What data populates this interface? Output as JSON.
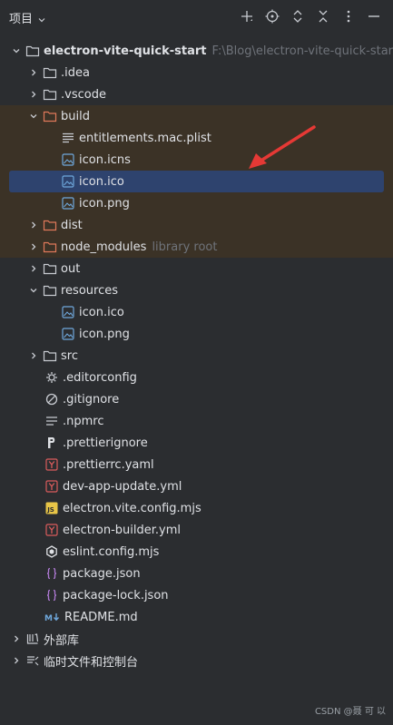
{
  "header": {
    "title": "项目",
    "toolbar": [
      "add-icon",
      "locate-icon",
      "expand-icon",
      "collapse-icon",
      "more-icon",
      "hide-icon"
    ]
  },
  "tree": {
    "root": {
      "label": "electron-vite-quick-start",
      "path": "F:\\Blog\\electron-vite-quick-start"
    },
    "items": [
      {
        "label": ".idea"
      },
      {
        "label": ".vscode"
      },
      {
        "label": "build"
      },
      {
        "label": "entitlements.mac.plist"
      },
      {
        "label": "icon.icns"
      },
      {
        "label": "icon.ico"
      },
      {
        "label": "icon.png"
      },
      {
        "label": "dist"
      },
      {
        "label": "node_modules",
        "hint": "library root"
      },
      {
        "label": "out"
      },
      {
        "label": "resources"
      },
      {
        "label": "icon.ico"
      },
      {
        "label": "icon.png"
      },
      {
        "label": "src"
      },
      {
        "label": ".editorconfig"
      },
      {
        "label": ".gitignore"
      },
      {
        "label": ".npmrc"
      },
      {
        "label": ".prettierignore"
      },
      {
        "label": ".prettierrc.yaml"
      },
      {
        "label": "dev-app-update.yml"
      },
      {
        "label": "electron.vite.config.mjs"
      },
      {
        "label": "electron-builder.yml"
      },
      {
        "label": "eslint.config.mjs"
      },
      {
        "label": "package.json"
      },
      {
        "label": "package-lock.json"
      },
      {
        "label": "README.md"
      },
      {
        "label": "外部库"
      },
      {
        "label": "临时文件和控制台"
      }
    ]
  },
  "footer": {
    "watermark": "CSDN @聂 可 以"
  },
  "colors": {
    "background": "#2b2d30",
    "selected": "#2e436e",
    "excluded_band": "#3b3226",
    "text": "#dfe1e5",
    "hint": "#6f737a",
    "arrow_red": "#e53935"
  }
}
